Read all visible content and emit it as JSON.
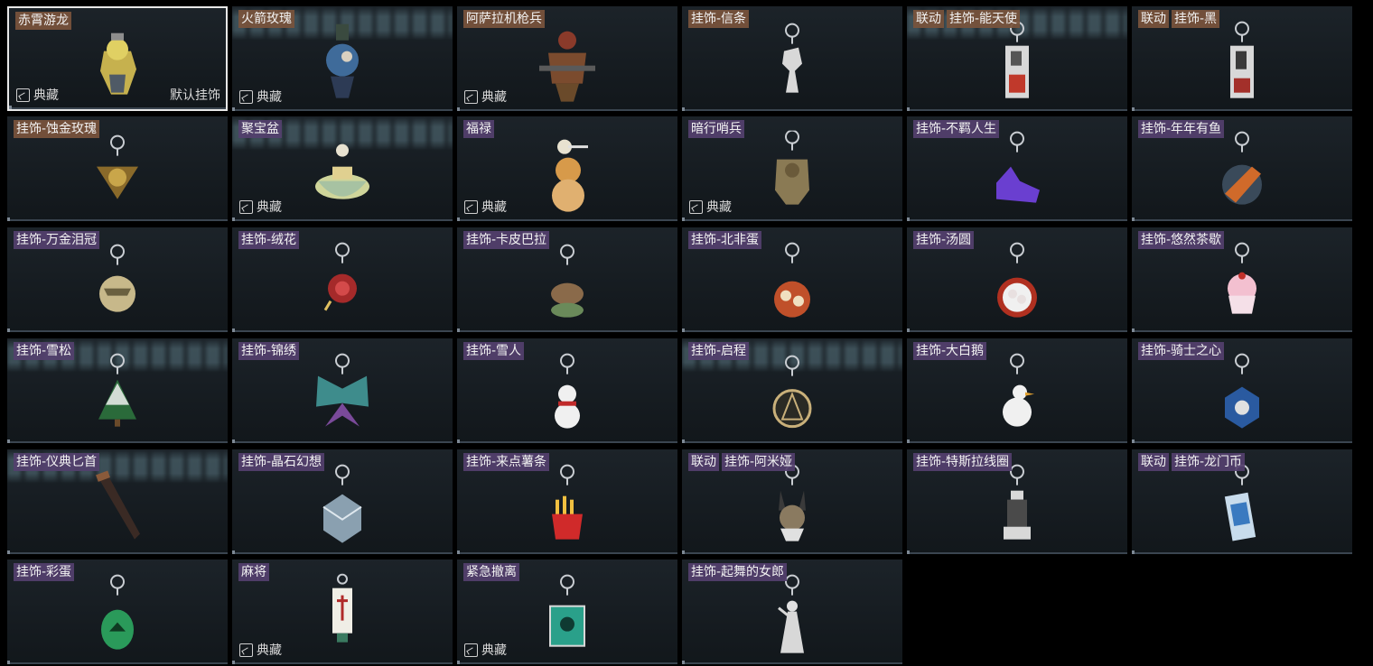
{
  "labels": {
    "collection": "典藏",
    "default_charm": "默认挂饰"
  },
  "colors": {
    "orange": "#7a543c",
    "purple": "#54406e",
    "selected_border": "#e8e8e8"
  },
  "items": [
    {
      "tags": [
        {
          "text": "赤霄游龙",
          "q": "orange"
        }
      ],
      "collection": true,
      "default": true,
      "selected": true,
      "art": "dragon-figure-icon"
    },
    {
      "tags": [
        {
          "text": "火箭玫瑰",
          "q": "orange"
        }
      ],
      "collection": true,
      "glare": true,
      "art": "rocket-rose-figure-icon"
    },
    {
      "tags": [
        {
          "text": "阿萨拉机枪兵",
          "q": "orange"
        }
      ],
      "collection": true,
      "art": "gunner-figure-icon"
    },
    {
      "tags": [
        {
          "text": "挂饰-信条",
          "q": "orange"
        }
      ],
      "art": "creed-charm-icon"
    },
    {
      "tags": [
        {
          "text": "联动",
          "q": "orange"
        },
        {
          "text": "挂饰-能天使",
          "q": "orange"
        }
      ],
      "glare": true,
      "art": "exusiai-charm-icon"
    },
    {
      "tags": [
        {
          "text": "联动",
          "q": "orange"
        },
        {
          "text": "挂饰-黑",
          "q": "orange"
        }
      ],
      "art": "schwarz-charm-icon"
    },
    {
      "tags": [
        {
          "text": "挂饰-蚀金玫瑰",
          "q": "orange"
        }
      ],
      "art": "gold-rose-charm-icon"
    },
    {
      "tags": [
        {
          "text": "聚宝盆",
          "q": "purple"
        }
      ],
      "collection": true,
      "glare": true,
      "art": "treasure-bowl-icon"
    },
    {
      "tags": [
        {
          "text": "福禄",
          "q": "purple"
        }
      ],
      "collection": true,
      "art": "gourd-figure-icon"
    },
    {
      "tags": [
        {
          "text": "暗行哨兵",
          "q": "purple"
        }
      ],
      "collection": true,
      "art": "sentinel-figure-icon"
    },
    {
      "tags": [
        {
          "text": "挂饰-不羁人生",
          "q": "purple"
        }
      ],
      "art": "sneaker-charm-icon"
    },
    {
      "tags": [
        {
          "text": "挂饰-年年有鱼",
          "q": "purple"
        }
      ],
      "art": "fish-charm-icon"
    },
    {
      "tags": [
        {
          "text": "挂饰-万金泪冠",
          "q": "purple"
        }
      ],
      "art": "crown-charm-icon"
    },
    {
      "tags": [
        {
          "text": "挂饰-绒花",
          "q": "purple"
        }
      ],
      "art": "velvet-flower-charm-icon"
    },
    {
      "tags": [
        {
          "text": "挂饰-卡皮巴拉",
          "q": "purple"
        }
      ],
      "art": "capybara-charm-icon"
    },
    {
      "tags": [
        {
          "text": "挂饰-北非蛋",
          "q": "purple"
        }
      ],
      "art": "shakshuka-charm-icon"
    },
    {
      "tags": [
        {
          "text": "挂饰-汤圆",
          "q": "purple"
        }
      ],
      "art": "tangyuan-charm-icon"
    },
    {
      "tags": [
        {
          "text": "挂饰-悠然茶歇",
          "q": "purple"
        }
      ],
      "art": "cupcake-charm-icon"
    },
    {
      "tags": [
        {
          "text": "挂饰-雪松",
          "q": "purple"
        }
      ],
      "glare": true,
      "art": "snow-pine-charm-icon"
    },
    {
      "tags": [
        {
          "text": "挂饰-锦绣",
          "q": "purple"
        }
      ],
      "art": "butterfly-charm-icon"
    },
    {
      "tags": [
        {
          "text": "挂饰-雪人",
          "q": "purple"
        }
      ],
      "art": "snowman-charm-icon"
    },
    {
      "tags": [
        {
          "text": "挂饰-启程",
          "q": "purple"
        }
      ],
      "glare": true,
      "art": "compass-charm-icon"
    },
    {
      "tags": [
        {
          "text": "挂饰-大白鹅",
          "q": "purple"
        }
      ],
      "art": "goose-charm-icon"
    },
    {
      "tags": [
        {
          "text": "挂饰-骑士之心",
          "q": "purple"
        }
      ],
      "art": "knight-heart-charm-icon"
    },
    {
      "tags": [
        {
          "text": "挂饰-仪典匕首",
          "q": "purple"
        }
      ],
      "glare": true,
      "art": "dagger-charm-icon"
    },
    {
      "tags": [
        {
          "text": "挂饰-晶石幻想",
          "q": "purple"
        }
      ],
      "art": "crystal-cube-charm-icon"
    },
    {
      "tags": [
        {
          "text": "挂饰-来点薯条",
          "q": "purple"
        }
      ],
      "art": "fries-charm-icon"
    },
    {
      "tags": [
        {
          "text": "联动",
          "q": "purple"
        },
        {
          "text": "挂饰-阿米娅",
          "q": "purple"
        }
      ],
      "art": "amiya-charm-icon"
    },
    {
      "tags": [
        {
          "text": "挂饰-特斯拉线圈",
          "q": "purple"
        }
      ],
      "art": "tesla-coil-charm-icon"
    },
    {
      "tags": [
        {
          "text": "联动",
          "q": "purple"
        },
        {
          "text": "挂饰-龙门币",
          "q": "purple"
        }
      ],
      "art": "lungmen-coin-charm-icon"
    },
    {
      "tags": [
        {
          "text": "挂饰-彩蛋",
          "q": "purple"
        }
      ],
      "art": "easter-egg-charm-icon"
    },
    {
      "tags": [
        {
          "text": "麻将",
          "q": "purple"
        }
      ],
      "collection": true,
      "art": "mahjong-tile-icon"
    },
    {
      "tags": [
        {
          "text": "紧急撤离",
          "q": "purple"
        }
      ],
      "collection": true,
      "art": "evac-sign-icon"
    },
    {
      "tags": [
        {
          "text": "挂饰-起舞的女郎",
          "q": "purple"
        }
      ],
      "art": "dancer-charm-icon"
    }
  ]
}
